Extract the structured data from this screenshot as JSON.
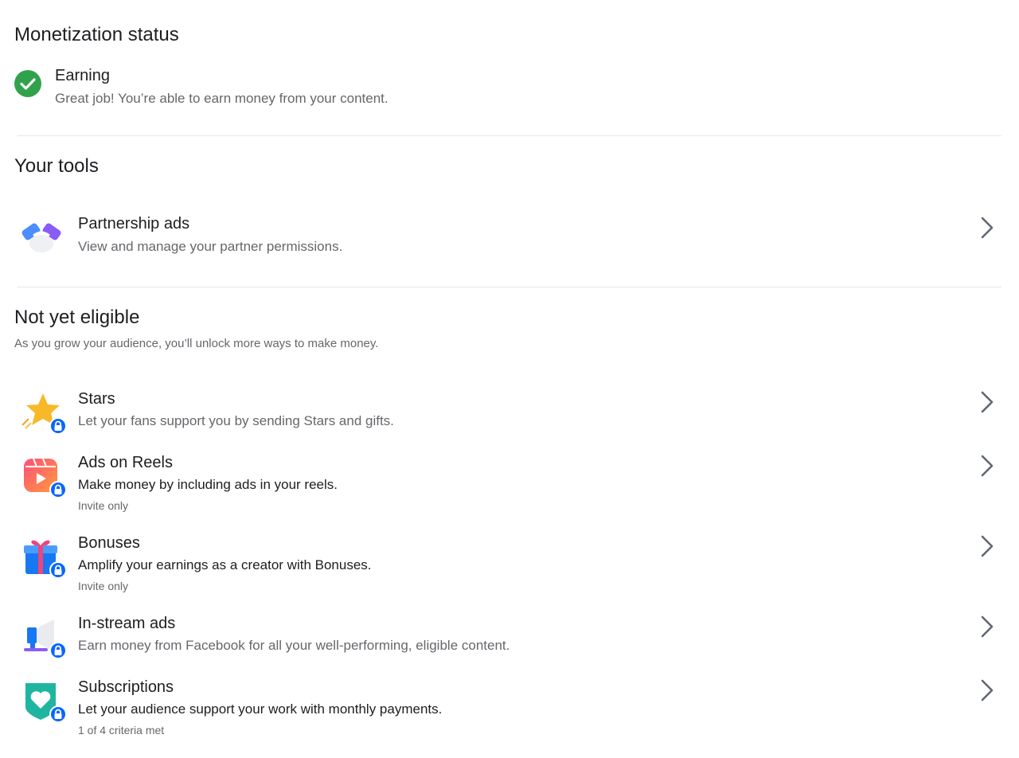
{
  "monetization": {
    "section_title": "Monetization status",
    "status_icon": "check-circle-icon",
    "status_title": "Earning",
    "status_desc": "Great job! You’re able to earn money from your content."
  },
  "tools": {
    "section_title": "Your tools",
    "items": [
      {
        "title": "Partnership ads",
        "desc": "View and manage your partner permissions.",
        "icon": "handshake-icon"
      }
    ]
  },
  "not_eligible": {
    "section_title": "Not yet eligible",
    "desc": "As you grow your audience, you’ll unlock more ways to make money.",
    "items": [
      {
        "title": "Stars",
        "desc": "Let your fans support you by sending Stars and gifts.",
        "note": "",
        "icon": "star-icon"
      },
      {
        "title": "Ads on Reels",
        "desc": "Make money by including ads in your reels.",
        "note": "Invite only",
        "icon": "reels-icon"
      },
      {
        "title": "Bonuses",
        "desc": "Amplify your earnings as a creator with Bonuses.",
        "note": "Invite only",
        "icon": "gift-icon"
      },
      {
        "title": "In-stream ads",
        "desc": "Earn money from Facebook for all your well-performing, eligible content.",
        "note": "",
        "icon": "megaphone-icon"
      },
      {
        "title": "Subscriptions",
        "desc": "Let your audience support your work with monthly payments.",
        "note": "1 of 4 criteria met",
        "icon": "heart-shield-icon"
      }
    ]
  },
  "colors": {
    "success": "#31a24c",
    "lock_badge": "#0866ff",
    "secondary_text": "#65676b",
    "divider": "#e4e6eb"
  }
}
